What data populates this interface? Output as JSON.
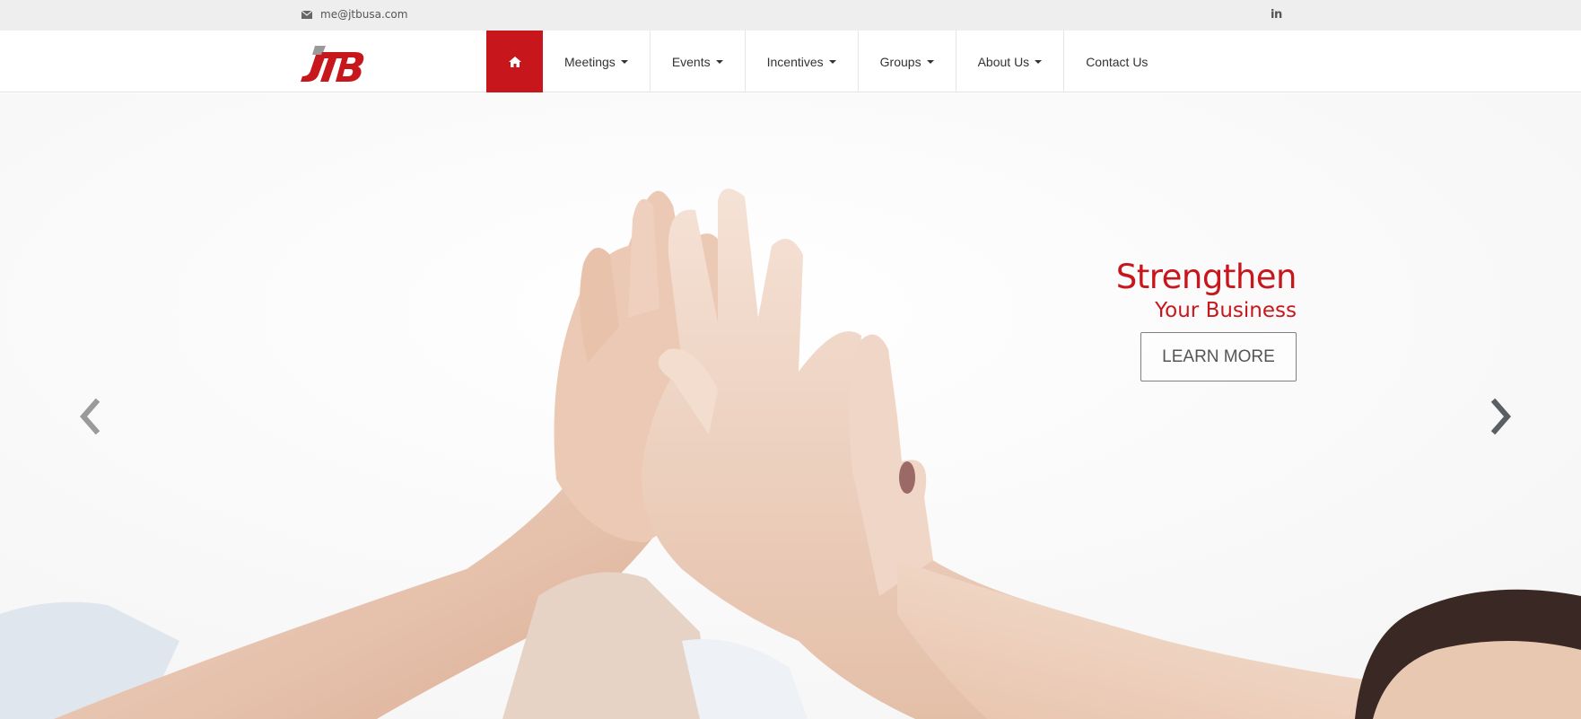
{
  "topbar": {
    "email": "me@jtbusa.com",
    "email_icon": "envelope-icon",
    "linkedin": "in"
  },
  "brand": {
    "logo_text": "JTB",
    "logo_color": "#c8161d"
  },
  "nav": {
    "home_icon": "home-icon",
    "items": [
      {
        "label": "Meetings",
        "dropdown": true
      },
      {
        "label": "Events",
        "dropdown": true
      },
      {
        "label": "Incentives",
        "dropdown": true
      },
      {
        "label": "Groups",
        "dropdown": true
      },
      {
        "label": "About Us",
        "dropdown": true
      },
      {
        "label": "Contact Us",
        "dropdown": false
      }
    ],
    "active": "home"
  },
  "hero": {
    "heading": "Strengthen",
    "subheading": "Your Business",
    "button_label": "LEARN MORE",
    "prev_icon": "chevron-left-icon",
    "next_icon": "chevron-right-icon"
  },
  "colors": {
    "accent": "#c8161d",
    "topbar_bg": "#eeeeee",
    "text": "#333333"
  }
}
